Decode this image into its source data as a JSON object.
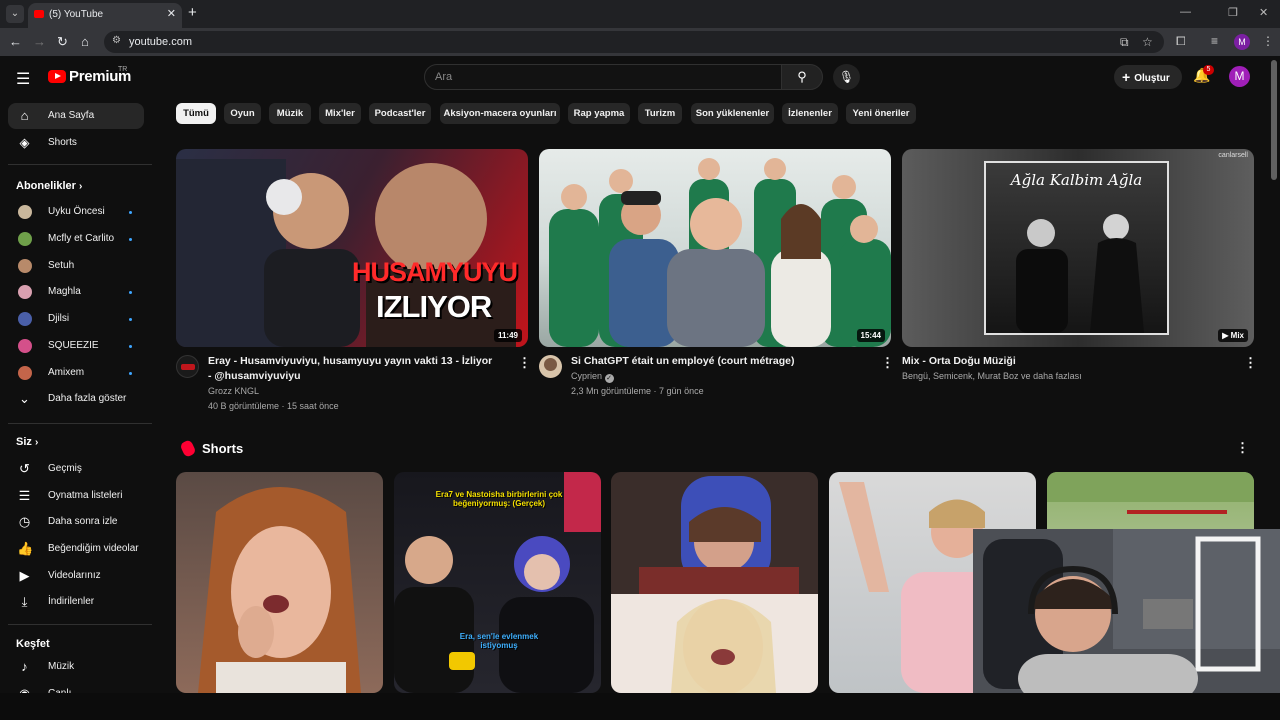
{
  "browser": {
    "tab_title": "(5) YouTube",
    "url": "youtube.com",
    "profile_initial": "M"
  },
  "header": {
    "logo_text": "Premium",
    "logo_country": "TR",
    "search_placeholder": "Ara",
    "create_label": "Oluştur",
    "notification_count": "5",
    "avatar_initial": "M"
  },
  "sidebar": {
    "main": [
      {
        "label": "Ana Sayfa",
        "icon": "home-icon"
      },
      {
        "label": "Shorts",
        "icon": "shorts-icon"
      }
    ],
    "subscriptions_heading": "Abonelikler",
    "subscriptions": [
      {
        "label": "Uyku Öncesi",
        "color": "#c9b79c",
        "new": true
      },
      {
        "label": "Mcfly et Carlito",
        "color": "#6fa04a",
        "new": true
      },
      {
        "label": "Setuh",
        "color": "#b88a6a",
        "new": false
      },
      {
        "label": "Maghla",
        "color": "#d9a0b0",
        "new": true
      },
      {
        "label": "Djilsi",
        "color": "#4a5fa8",
        "new": true
      },
      {
        "label": "SQUEEZIE",
        "color": "#d4508a",
        "new": true
      },
      {
        "label": "Amixem",
        "color": "#c4654a",
        "new": true
      }
    ],
    "show_more": "Daha fazla göster",
    "you_heading": "Siz",
    "you_items": [
      {
        "label": "Geçmiş",
        "icon": "history-icon"
      },
      {
        "label": "Oynatma listeleri",
        "icon": "playlists-icon"
      },
      {
        "label": "Daha sonra izle",
        "icon": "watch-later-icon"
      },
      {
        "label": "Beğendiğim videolar",
        "icon": "like-icon"
      },
      {
        "label": "Videolarınız",
        "icon": "your-videos-icon"
      },
      {
        "label": "İndirilenler",
        "icon": "download-icon"
      }
    ],
    "explore_heading": "Keşfet",
    "explore_items": [
      {
        "label": "Müzik",
        "icon": "music-icon"
      },
      {
        "label": "Canlı",
        "icon": "live-icon"
      }
    ]
  },
  "chips": [
    "Tümü",
    "Oyun",
    "Müzik",
    "Mix'ler",
    "Podcast'ler",
    "Aksiyon-macera oyunları",
    "Rap yapma",
    "Turizm",
    "Son yüklenenler",
    "İzlenenler",
    "Yeni öneriler"
  ],
  "videos": [
    {
      "title": "Eray - Husamviyuviyu, husamyuyu yayın vakti 13 - İzliyor - @husamviyuviyu",
      "channel": "Grozz KNGL",
      "meta": "40 B görüntüleme · 15 saat önce",
      "duration": "11:49",
      "thumb_text_1": "HUSAMYUYU",
      "thumb_text_2": "IZLIYOR"
    },
    {
      "title": "Si ChatGPT était un employé (court métrage)",
      "channel": "Cyprien",
      "meta": "2,3 Mn görüntüleme · 7 gün önce",
      "duration": "15:44"
    },
    {
      "title": "Mix - Orta Doğu Müziği",
      "channel": "Bengü, Semicenk, Murat Boz ve daha fazlası",
      "duration": "Mix",
      "thumb_text_1": "Ağla Kalbim Ağla",
      "thumb_credit": "canlarsell"
    }
  ],
  "shorts": {
    "heading": "Shorts",
    "items": [
      {
        "caption": ""
      },
      {
        "caption_top": "Era7 ve Nastoisha birbirlerini çok beğeniyormuş: (Gerçek)",
        "caption_bottom": "Era, sen'le evlenmek istiyomuş"
      },
      {
        "caption": ""
      },
      {
        "caption": ""
      },
      {
        "caption": ""
      }
    ]
  }
}
